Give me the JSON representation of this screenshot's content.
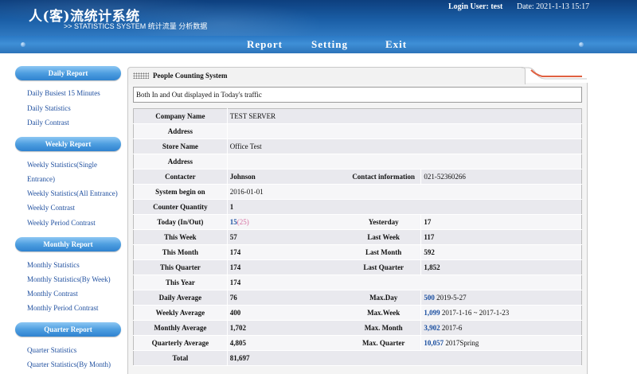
{
  "header": {
    "app_title": "人(客)流统计系统",
    "app_subtitle": ">> STATISTICS SYSTEM  统计流量  分析数据",
    "login": "Login User: test",
    "date": "Date: 2021-1-13 15:17"
  },
  "nav": {
    "items": [
      "Report",
      "Setting",
      "Exit"
    ]
  },
  "sidebar": {
    "sections": [
      {
        "title": "Daily Report",
        "links": [
          "Daily Busiest 15 Minutes",
          "Daily Statistics",
          "Daily Contrast"
        ]
      },
      {
        "title": "Weekly Report",
        "links": [
          "Weekly Statistics(Single",
          "Entrance)",
          "Weekly Statistics(All Entrance)",
          "Weekly Contrast",
          "Weekly Period Contrast"
        ]
      },
      {
        "title": "Monthly Report",
        "links": [
          "Monthly Statistics",
          "Monthly Statistics(By Week)",
          "Monthly Contrast",
          "Monthly Period Contrast"
        ]
      },
      {
        "title": "Quarter Report",
        "links": [
          "Quarter Statistics",
          "Quarter Statistics(By Month)"
        ]
      }
    ]
  },
  "panel": {
    "title": "People Counting System",
    "notice": "Both In and Out displayed in Today's traffic"
  },
  "table": {
    "company_name_label": "Company Name",
    "company_name": "TEST SERVER",
    "address_label_1": "Address",
    "address_1": "",
    "store_name_label": "Store Name",
    "store_name": "Office Test",
    "address_label_2": "Address",
    "address_2": "",
    "contacter_label": "Contacter",
    "contacter": "Johnson",
    "contact_info_label": "Contact information",
    "contact_info": "021-52360266",
    "system_begin_label": "System begin on",
    "system_begin": "2016-01-01",
    "counter_qty_label": "Counter Quantity",
    "counter_qty": "1",
    "today_label": "Today (In/Out)",
    "today_in": "15",
    "today_out": "(25)",
    "yesterday_label": "Yesterday",
    "yesterday": "17",
    "this_week_label": "This Week",
    "this_week": "57",
    "last_week_label": "Last Week",
    "last_week": "117",
    "this_month_label": "This Month",
    "this_month": "174",
    "last_month_label": "Last Month",
    "last_month": "592",
    "this_quarter_label": "This Quarter",
    "this_quarter": "174",
    "last_quarter_label": "Last Quarter",
    "last_quarter": "1,852",
    "this_year_label": "This Year",
    "this_year": "174",
    "daily_avg_label": "Daily Average",
    "daily_avg": "76",
    "max_day_label": "Max.Day",
    "max_day_value": "500",
    "max_day_date": "2019-5-27",
    "weekly_avg_label": "Weekly Average",
    "weekly_avg": "400",
    "max_week_label": "Max.Week",
    "max_week_value": "1,099",
    "max_week_date": "2017-1-16 ~ 2017-1-23",
    "monthly_avg_label": "Monthly Average",
    "monthly_avg": "1,702",
    "max_month_label": "Max. Month",
    "max_month_value": "3,902",
    "max_month_date": "2017-6",
    "quarterly_avg_label": "Quarterly Average",
    "quarterly_avg": "4,805",
    "max_quarter_label": "Max. Quarter",
    "max_quarter_value": "10,057",
    "max_quarter_date": "2017Spring",
    "total_label": "Total",
    "total": "81,697"
  },
  "colors": {
    "header_dark": "#0d3f7e",
    "nav_blue": "#3f8fd6",
    "sidebar_pill": "#4d9ee0",
    "link_blue": "#1f4f9f",
    "value_blue": "#1b4fa0",
    "out_pink": "#d66fa0",
    "tab_accent": "#e06040"
  }
}
